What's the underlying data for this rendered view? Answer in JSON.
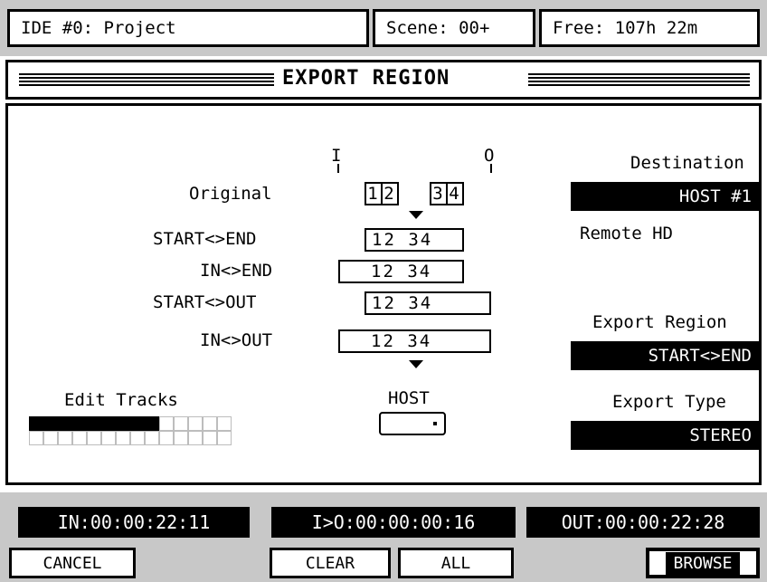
{
  "top": {
    "project": "IDE #0: Project",
    "scene": "Scene: 00+",
    "free": "Free: 107h 22m"
  },
  "title": "EXPORT REGION",
  "markers": {
    "in": "I",
    "out": "O"
  },
  "rows": [
    {
      "label": "Original",
      "tracks": "12 34"
    },
    {
      "label": "START<>END",
      "tracks": "12 34"
    },
    {
      "label": "IN<>END",
      "tracks": "12 34"
    },
    {
      "label": "START<>OUT",
      "tracks": "12 34"
    },
    {
      "label": "IN<>OUT",
      "tracks": "12 34"
    }
  ],
  "original_tracks": {
    "a": "1",
    "b": "2",
    "c": "3",
    "d": "4"
  },
  "edit_tracks": {
    "label": "Edit Tracks",
    "active_count": 9,
    "total_per_row": 14
  },
  "host": {
    "label": "HOST"
  },
  "destination": {
    "label": "Destination",
    "value": "HOST #1",
    "sub": "Remote HD"
  },
  "export_region": {
    "label": "Export Region",
    "value": "START<>END"
  },
  "export_type": {
    "label": "Export Type",
    "value": "STEREO"
  },
  "times": {
    "in": "IN:00:00:22:11",
    "length": "I>O:00:00:00:16",
    "out": "OUT:00:00:22:28"
  },
  "buttons": {
    "cancel": "CANCEL",
    "clear": "CLEAR",
    "all": "ALL",
    "browse": "BROWSE"
  }
}
